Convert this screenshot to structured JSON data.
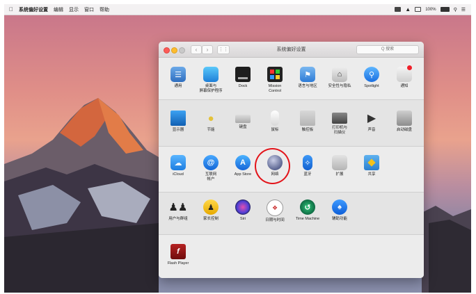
{
  "menubar": {
    "apple_icon": "apple-logo-icon",
    "items": [
      "系统偏好设置",
      "编辑",
      "显示",
      "窗口",
      "帮助"
    ],
    "status": {
      "battery": "100%"
    }
  },
  "window": {
    "title": "系统偏好设置",
    "search_placeholder": "Q 搜索",
    "sections": [
      {
        "panes": [
          {
            "label": "通用",
            "icon": "general-icon"
          },
          {
            "label": "桌面与\n屏幕保护程序",
            "icon": "desktop-icon"
          },
          {
            "label": "Dock",
            "icon": "dock-icon"
          },
          {
            "label": "Mission\nControl",
            "icon": "mission-control-icon"
          },
          {
            "label": "语言与地区",
            "icon": "flag-icon"
          },
          {
            "label": "安全性与隐私",
            "icon": "lock-house-icon"
          },
          {
            "label": "Spotlight",
            "icon": "spotlight-icon"
          },
          {
            "label": "通知",
            "icon": "notifications-icon"
          }
        ]
      },
      {
        "panes": [
          {
            "label": "显示器",
            "icon": "display-icon"
          },
          {
            "label": "节能",
            "icon": "bulb-icon"
          },
          {
            "label": "键盘",
            "icon": "keyboard-icon"
          },
          {
            "label": "鼠标",
            "icon": "mouse-icon"
          },
          {
            "label": "触控板",
            "icon": "trackpad-icon"
          },
          {
            "label": "打印机与\n扫描仪",
            "icon": "printer-icon"
          },
          {
            "label": "声音",
            "icon": "speaker-icon"
          },
          {
            "label": "启动磁盘",
            "icon": "disk-icon"
          }
        ]
      },
      {
        "panes": [
          {
            "label": "iCloud",
            "icon": "icloud-icon"
          },
          {
            "label": "互联网\n帐户",
            "icon": "at-icon"
          },
          {
            "label": "App Store",
            "icon": "app-store-icon"
          },
          {
            "label": "网络",
            "icon": "network-globe-icon"
          },
          {
            "label": "蓝牙",
            "icon": "bluetooth-icon"
          },
          {
            "label": "扩展",
            "icon": "puzzle-icon"
          },
          {
            "label": "共享",
            "icon": "sharing-icon"
          }
        ]
      },
      {
        "panes": [
          {
            "label": "用户与群组",
            "icon": "users-icon"
          },
          {
            "label": "家长控制",
            "icon": "parental-icon"
          },
          {
            "label": "Siri",
            "icon": "siri-icon"
          },
          {
            "label": "日期与时间",
            "icon": "clock-icon"
          },
          {
            "label": "Time Machine",
            "icon": "time-machine-icon"
          },
          {
            "label": "辅助功能",
            "icon": "accessibility-icon"
          }
        ]
      },
      {
        "panes": [
          {
            "label": "Flash Player",
            "icon": "flash-icon"
          }
        ]
      }
    ]
  }
}
